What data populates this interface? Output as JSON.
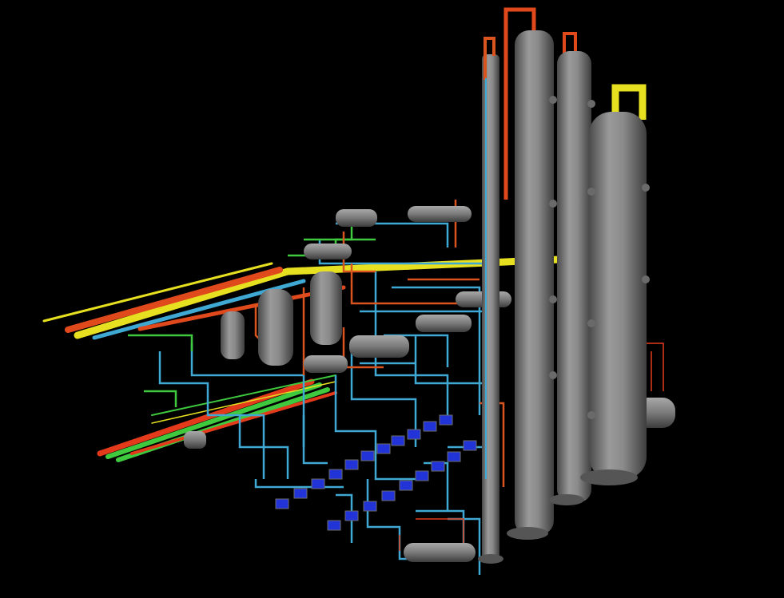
{
  "scene": {
    "background": "#000000",
    "colors": {
      "vessel": "#8c8c8c",
      "vessel_dark": "#4a4a4a",
      "pipe_blue": "#3fa9d4",
      "pipe_red": "#e23a1a",
      "pipe_orange": "#d9541e",
      "pipe_green": "#3ec93e",
      "pipe_yellow": "#e6e020",
      "pump_blue": "#2233d8"
    },
    "objects": [
      "distillation-column",
      "distillation-column",
      "distillation-column",
      "tall-stack",
      "vertical-drum",
      "horizontal-heat-exchanger",
      "pump",
      "pipe-rack"
    ]
  }
}
